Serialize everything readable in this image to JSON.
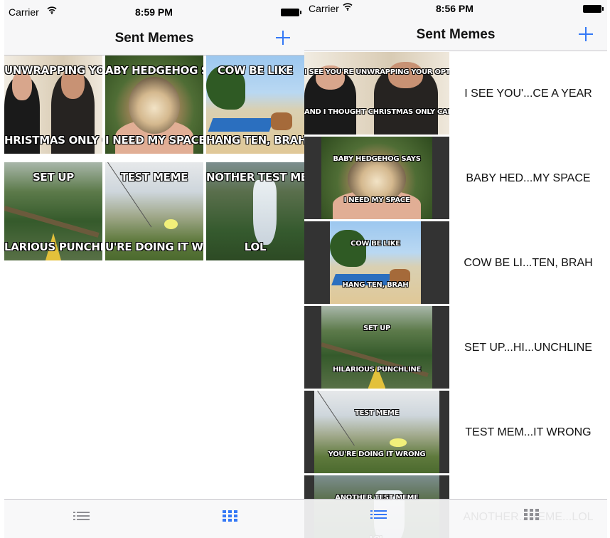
{
  "left": {
    "status": {
      "carrier": "Carrier",
      "time": "8:59 PM"
    },
    "nav": {
      "title": "Sent Memes"
    },
    "grid": [
      {
        "top": "UNWRAPPING YOU",
        "bottom": "HRISTMAS ONLY CA",
        "theme": "bond"
      },
      {
        "top": "ABY HEDGEHOG SAY",
        "bottom": "I NEED MY SPACE",
        "theme": "hedgehog"
      },
      {
        "top": "COW BE LIKE",
        "bottom": "HANG TEN, BRAH",
        "theme": "cow"
      },
      {
        "top": "SET UP",
        "bottom": "LARIOUS PUNCHLI",
        "theme": "setup"
      },
      {
        "top": "TEST MEME",
        "bottom": "U'RE DOING IT WRO",
        "theme": "test"
      },
      {
        "top": "NOTHER TEST MEM",
        "bottom": "LOL",
        "theme": "falls"
      }
    ],
    "tabs": {
      "active": "grid"
    }
  },
  "right": {
    "status": {
      "carrier": "Carrier",
      "time": "8:56 PM"
    },
    "nav": {
      "title": "Sent Memes"
    },
    "rows": [
      {
        "label": "I SEE YOU'...CE A YEAR",
        "top": "I SEE YOU'RE UNWRAPPING YOUR OPTIONALS",
        "bottom": "AND I THOUGHT CHRISTMAS ONLY CAME ONCE A YEAR",
        "theme": "bond"
      },
      {
        "label": "BABY HED...MY SPACE",
        "top": "BABY HEDGEHOG SAYS",
        "bottom": "I NEED MY SPACE",
        "theme": "hedgehog"
      },
      {
        "label": "COW BE LI...TEN, BRAH",
        "top": "COW BE LIKE",
        "bottom": "HANG TEN, BRAH",
        "theme": "cow"
      },
      {
        "label": "SET UP...HI...UNCHLINE",
        "top": "SET UP",
        "bottom": "HILARIOUS PUNCHLINE",
        "theme": "setup"
      },
      {
        "label": "TEST MEM...IT WRONG",
        "top": "TEST MEME",
        "bottom": "YOU'RE DOING IT WRONG",
        "theme": "test"
      },
      {
        "label": "ANOTHER...MEME...LOL",
        "top": "ANOTHER TEST MEME",
        "bottom": "LOL",
        "theme": "falls"
      }
    ],
    "tabs": {
      "active": "list"
    }
  },
  "colors": {
    "accent": "#3478f6",
    "inactive_tab": "#8e8e93"
  },
  "icons": {
    "add": "plus-icon",
    "list_tab": "list-icon",
    "grid_tab": "grid-icon",
    "wifi": "wifi-icon",
    "battery": "battery-icon"
  }
}
